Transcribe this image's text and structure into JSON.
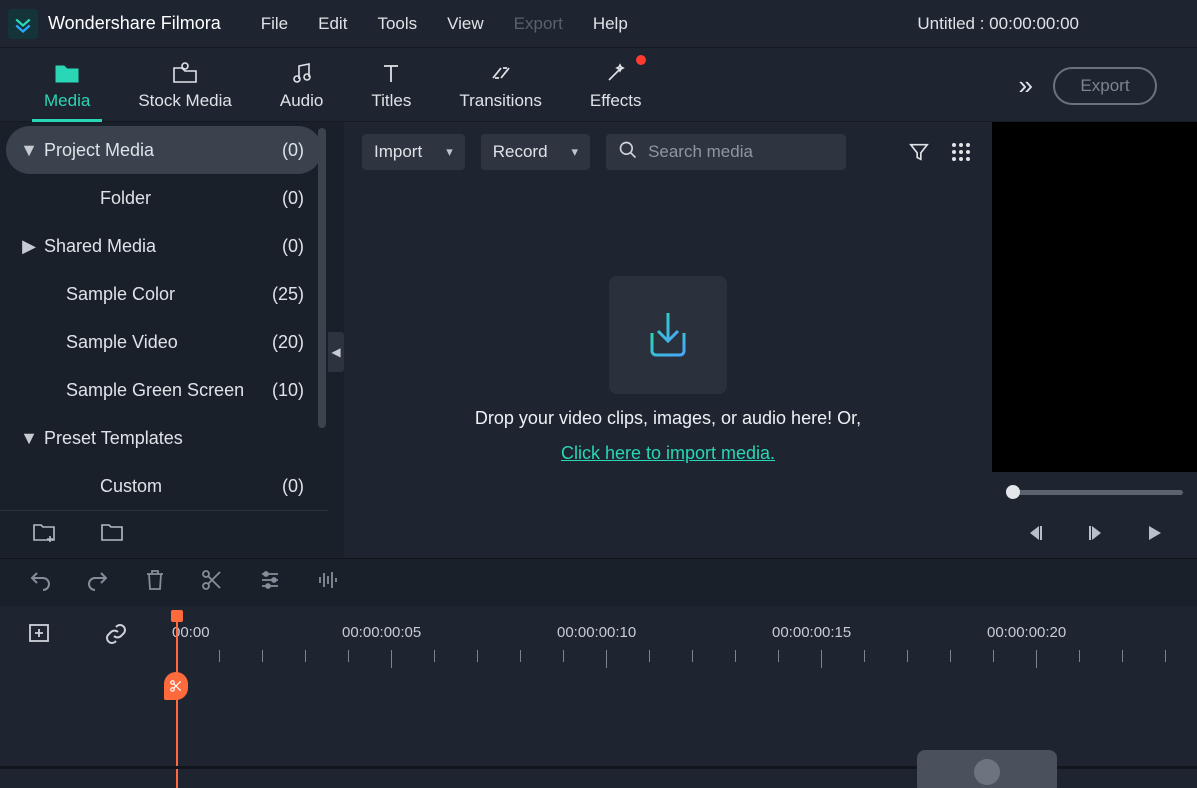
{
  "app": {
    "title": "Wondershare Filmora"
  },
  "menu": {
    "file": "File",
    "edit": "Edit",
    "tools": "Tools",
    "view": "View",
    "export": "Export",
    "help": "Help"
  },
  "project": {
    "title": "Untitled : 00:00:00:00"
  },
  "tabs": {
    "media": "Media",
    "stock": "Stock Media",
    "audio": "Audio",
    "titles": "Titles",
    "transitions": "Transitions",
    "effects": "Effects",
    "export_button": "Export"
  },
  "tree": {
    "project_media": {
      "label": "Project Media",
      "count": "(0)"
    },
    "folder": {
      "label": "Folder",
      "count": "(0)"
    },
    "shared_media": {
      "label": "Shared Media",
      "count": "(0)"
    },
    "sample_color": {
      "label": "Sample Color",
      "count": "(25)"
    },
    "sample_video": {
      "label": "Sample Video",
      "count": "(20)"
    },
    "sample_green": {
      "label": "Sample Green Screen",
      "count": "(10)"
    },
    "preset_templates": {
      "label": "Preset Templates"
    },
    "custom": {
      "label": "Custom",
      "count": "(0)"
    }
  },
  "media_toolbar": {
    "import": "Import",
    "record": "Record",
    "search_placeholder": "Search media"
  },
  "dropzone": {
    "text": "Drop your video clips, images, or audio here! Or,",
    "link": "Click here to import media."
  },
  "ruler": {
    "t0": "00:00",
    "t1": "00:00:00:05",
    "t2": "00:00:00:10",
    "t3": "00:00:00:15",
    "t4": "00:00:00:20"
  }
}
